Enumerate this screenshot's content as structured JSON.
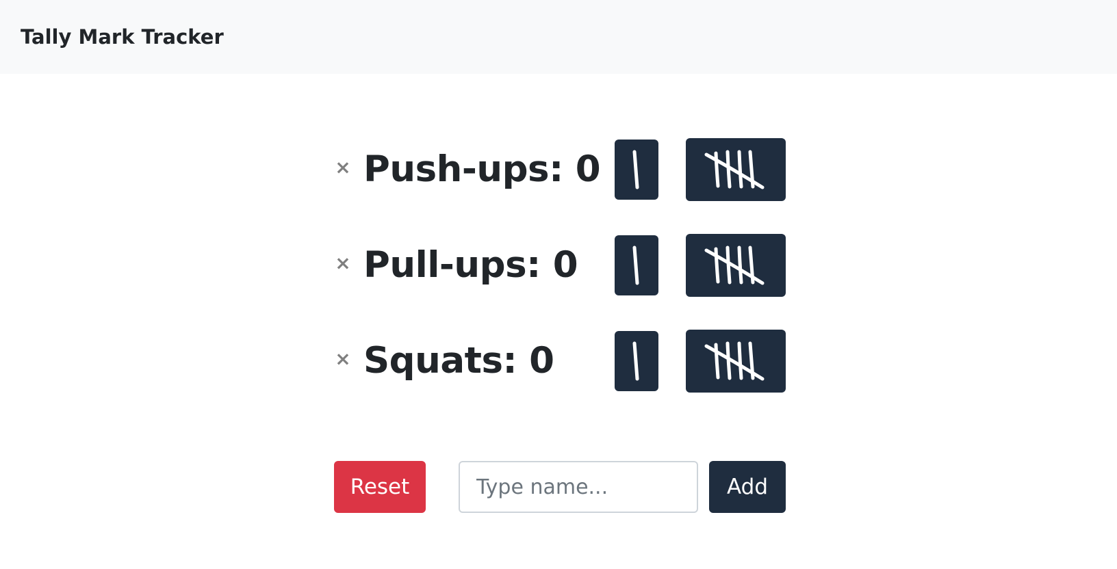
{
  "app": {
    "title": "Tally Mark Tracker"
  },
  "counters": [
    {
      "label": "Push-ups: 0",
      "remove_icon": "×"
    },
    {
      "label": "Pull-ups: 0",
      "remove_icon": "×"
    },
    {
      "label": "Squats: 0",
      "remove_icon": "×"
    }
  ],
  "controls": {
    "reset_label": "Reset",
    "name_input_value": "",
    "name_input_placeholder": "Type name...",
    "add_label": "Add"
  },
  "icons": {
    "add_one": "tally-one-icon",
    "add_five": "tally-five-icon",
    "remove": "close-icon"
  },
  "colors": {
    "dark_button": "#1f2d3f",
    "reset_button": "#dc3545",
    "navbar_bg": "#f8f9fa",
    "remove_icon": "#808080"
  }
}
